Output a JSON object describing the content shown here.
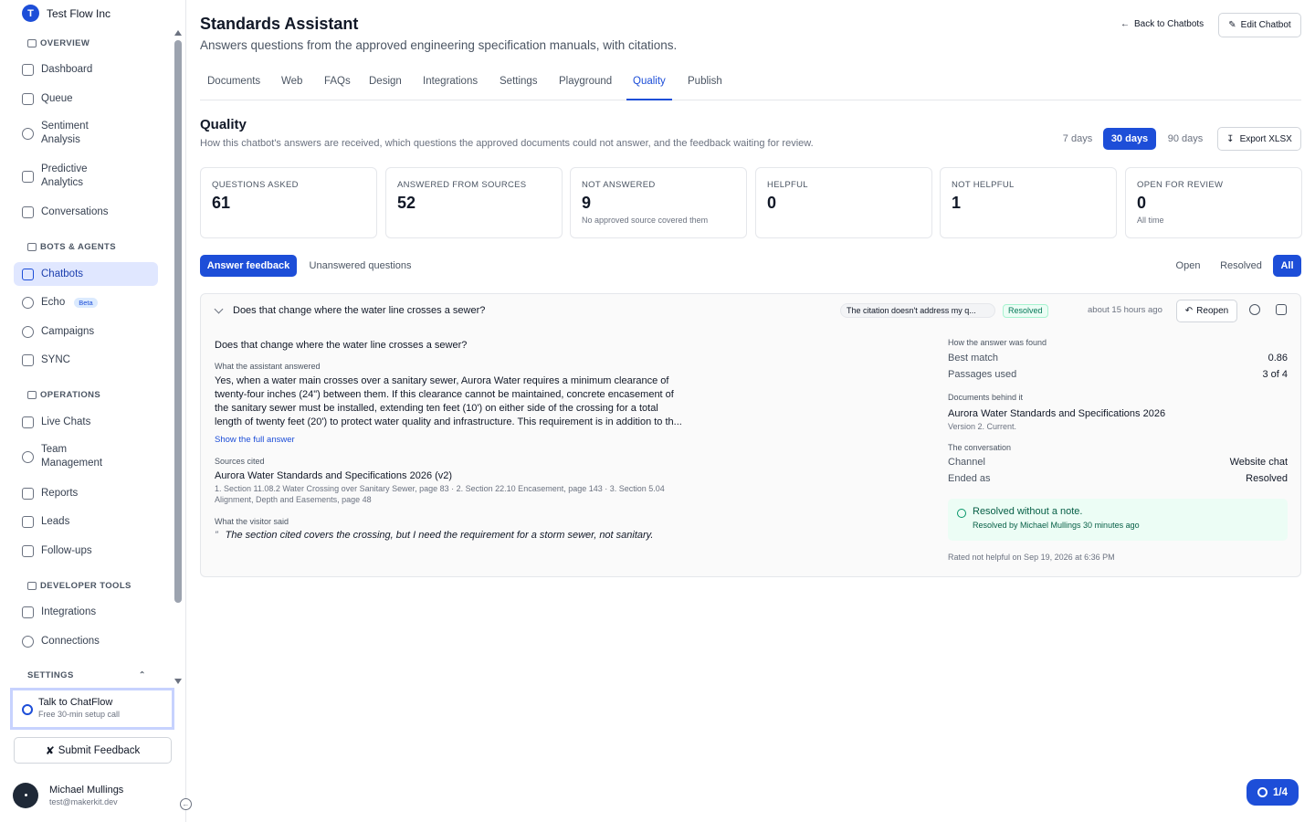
{
  "org": {
    "initial": "T",
    "name": "Test Flow Inc"
  },
  "sidebar": {
    "sections": {
      "overview": "OVERVIEW",
      "bots": "BOTS & AGENTS",
      "operations": "OPERATIONS",
      "developer": "DEVELOPER TOOLS",
      "settings": "SETTINGS"
    },
    "items": {
      "dashboard": "Dashboard",
      "queue": "Queue",
      "sentiment": "Sentiment Analysis",
      "predictive": "Predictive Analytics",
      "conversations": "Conversations",
      "chatbots": "Chatbots",
      "echo": "Echo",
      "echo_badge": "Beta",
      "campaigns": "Campaigns",
      "sync": "SYNC",
      "live_chats": "Live Chats",
      "team": "Team Management",
      "reports": "Reports",
      "leads": "Leads",
      "followups": "Follow-ups",
      "integrations": "Integrations",
      "connections": "Connections"
    },
    "talk": {
      "title": "Talk to ChatFlow",
      "subtitle": "Free 30-min setup call"
    },
    "feedback_label": "Submit Feedback",
    "user": {
      "name": "Michael Mullings",
      "email": "test@makerkit.dev"
    }
  },
  "header": {
    "title": "Standards Assistant",
    "subtitle": "Answers questions from the approved engineering specification manuals, with citations.",
    "back_label": "Back to Chatbots",
    "edit_label": "Edit Chatbot"
  },
  "tabs": [
    "Documents",
    "Web",
    "FAQs",
    "Design",
    "Integrations",
    "Settings",
    "Playground",
    "Quality",
    "Publish"
  ],
  "active_tab": "Quality",
  "quality": {
    "title": "Quality",
    "subtitle": "How this chatbot's answers are received, which questions the approved documents could not answer, and the feedback waiting for review.",
    "ranges": [
      "7 days",
      "30 days",
      "90 days"
    ],
    "active_range": "30 days",
    "export_label": "Export XLSX"
  },
  "stats": [
    {
      "label": "QUESTIONS ASKED",
      "value": "61",
      "note": ""
    },
    {
      "label": "ANSWERED FROM SOURCES",
      "value": "52",
      "note": ""
    },
    {
      "label": "NOT ANSWERED",
      "value": "9",
      "note": "No approved source covered them"
    },
    {
      "label": "HELPFUL",
      "value": "0",
      "note": ""
    },
    {
      "label": "NOT HELPFUL",
      "value": "1",
      "note": ""
    },
    {
      "label": "OPEN FOR REVIEW",
      "value": "0",
      "note": "All time"
    }
  ],
  "views": {
    "feedback": "Answer feedback",
    "unanswered": "Unanswered questions"
  },
  "filters": {
    "open": "Open",
    "resolved": "Resolved",
    "all": "All"
  },
  "feedback_item": {
    "question": "Does that change where the water line crosses a sewer?",
    "reason": "The citation doesn't address my q...",
    "status": "Resolved",
    "time_ago": "about 15 hours ago",
    "reopen_label": "Reopen",
    "answer_label": "What the assistant answered",
    "answer_lines": [
      "Yes, when a water main crosses over a sanitary sewer, Aurora Water requires a minimum clearance of",
      "twenty-four inches (24\") between them. If this clearance cannot be maintained, concrete encasement of",
      "the sanitary sewer must be installed, extending ten feet (10') on either side of the crossing for a total",
      "length of twenty feet (20') to protect water quality and infrastructure. This requirement is in addition to th..."
    ],
    "show_full": "Show the full answer",
    "sources_label": "Sources cited",
    "source_name": "Aurora Water Standards and Specifications 2026 (v2)",
    "source_pages_1": "1. Section 11.08.2 Water Crossing over Sanitary Sewer, page 83 · 2. Section 22.10 Encasement, page 143 · 3. Section 5.04",
    "source_pages_2": "Alignment, Depth and Easements, page 48",
    "visitor_label": "What the visitor said",
    "visitor_quote": "The section cited covers the crossing, but I need the requirement for a storm sewer, not sanitary.",
    "how_label": "How the answer was found",
    "best_match_label": "Best match",
    "best_match": "0.86",
    "passages_label": "Passages used",
    "passages": "3 of 4",
    "docs_label": "Documents behind it",
    "doc_name": "Aurora Water Standards and Specifications 2026",
    "doc_version": "Version 2. Current.",
    "conv_label": "The conversation",
    "channel_label": "Channel",
    "channel": "Website chat",
    "ended_label": "Ended as",
    "ended": "Resolved",
    "resolved_title": "Resolved without a note.",
    "resolved_by": "Resolved by Michael Mullings 30 minutes ago",
    "rated": "Rated not helpful on Sep 19, 2026 at 6:36 PM"
  },
  "fab_label": "1/4",
  "colors": {
    "accent": "#1d4ed8",
    "success": "#047857",
    "muted": "#6b7280"
  }
}
